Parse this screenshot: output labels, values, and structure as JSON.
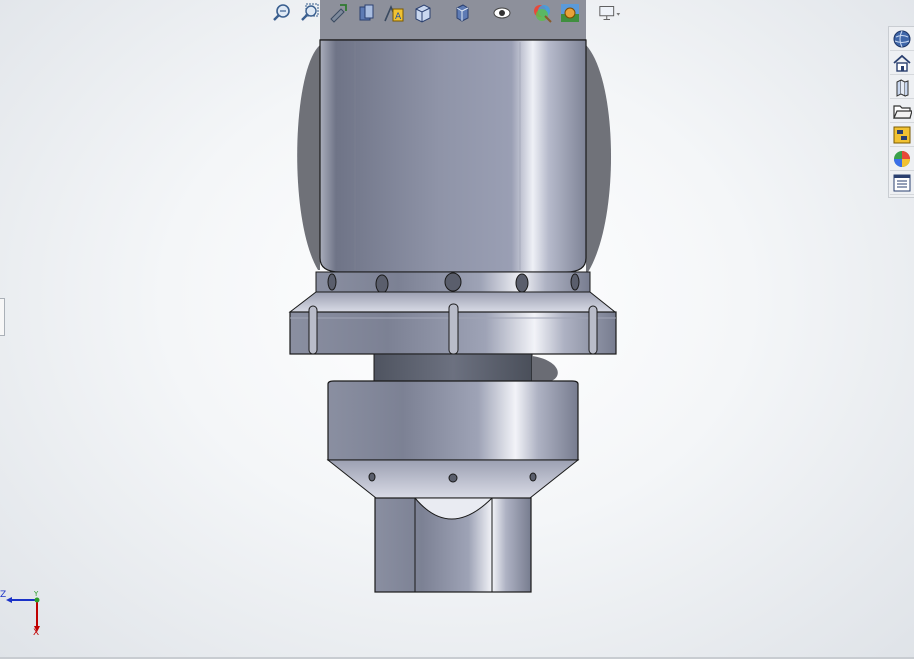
{
  "window": {
    "title": ""
  },
  "toolbar": {
    "items": [
      {
        "name": "zoom-to-fit",
        "icon": "zoom-fit-icon"
      },
      {
        "name": "zoom-to-area",
        "icon": "zoom-area-icon"
      },
      {
        "name": "previous-view",
        "icon": "previous-view-icon"
      },
      {
        "name": "section-view",
        "icon": "section-view-icon"
      },
      {
        "name": "dynamic-annotation",
        "icon": "annotation-view-icon"
      },
      {
        "name": "view-orientation",
        "icon": "view-orientation-icon"
      },
      {
        "name": "display-style",
        "icon": "display-style-icon"
      },
      {
        "name": "hide-show-items",
        "icon": "hide-show-icon"
      },
      {
        "name": "edit-appearance",
        "icon": "edit-appearance-icon"
      },
      {
        "name": "apply-scene",
        "icon": "apply-scene-icon"
      },
      {
        "name": "view-settings",
        "icon": "monitor-icon"
      }
    ]
  },
  "task_pane": {
    "items": [
      {
        "name": "solidworks-resources",
        "icon": "globe-icon"
      },
      {
        "name": "home",
        "icon": "home-icon"
      },
      {
        "name": "design-library",
        "icon": "library-icon"
      },
      {
        "name": "file-explorer",
        "icon": "folder-icon"
      },
      {
        "name": "view-palette",
        "icon": "palette-icon"
      },
      {
        "name": "appearances-scenes",
        "icon": "color-ball-icon"
      },
      {
        "name": "custom-properties",
        "icon": "properties-icon"
      }
    ]
  },
  "triad": {
    "axis_z": "Z",
    "axis_y": "Y",
    "axis_x": "X"
  },
  "colors": {
    "accent": "#1f4fa0",
    "axis_x": "#c00000",
    "axis_y": "#2a9d2a",
    "axis_z": "#1a32c8",
    "part_metal": "#8a8fa0"
  }
}
